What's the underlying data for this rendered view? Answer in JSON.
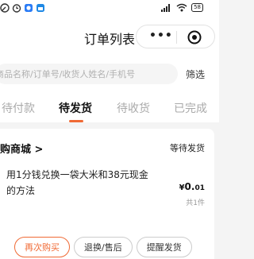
{
  "status_bar": {
    "battery": "58"
  },
  "nav": {
    "title": "订单列表"
  },
  "search": {
    "placeholder": "商品名称/订单号/收货人姓名/手机号",
    "filter_label": "筛选"
  },
  "tabs": [
    {
      "label": "待付款",
      "active": false
    },
    {
      "label": "待发货",
      "active": true
    },
    {
      "label": "待收货",
      "active": false
    },
    {
      "label": "已完成",
      "active": false
    }
  ],
  "order": {
    "shop_name": "购商城",
    "shop_chevron": ">",
    "status": "等待发货",
    "goods_title": "用1分钱兑换一袋大米和38元现金的方法",
    "price_symbol": "¥",
    "price_int": "0.",
    "price_dec": "01",
    "quantity": "共1件",
    "buttons": {
      "rebuy": "再次购买",
      "refund": "退换/售后",
      "remind": "提醒发货"
    }
  },
  "colors": {
    "accent": "#f06a35",
    "text": "#222222",
    "muted": "#aaaaaa",
    "background": "#f4f4f4"
  }
}
